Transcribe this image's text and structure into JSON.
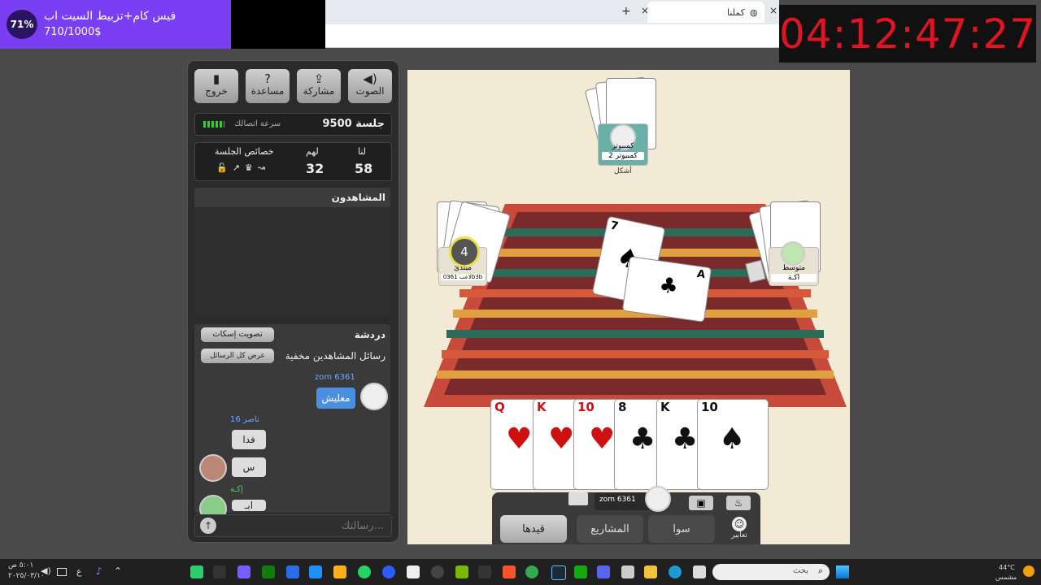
{
  "overlay": {
    "percent": "71%",
    "title": "فيس كام+تزبيط السيت اب",
    "value": "710/1000$",
    "progress": 0.71
  },
  "timer": "04:12:47:27",
  "browser": {
    "tab_title": "كملنا",
    "new_tab": "+",
    "close": "×"
  },
  "toolbar": {
    "exit": "خروج",
    "help": "مساعدة",
    "share": "مشاركة",
    "sound": "الصوت"
  },
  "session": {
    "label": "جلسة 9500",
    "speed_label": "سرعة اتصالك"
  },
  "score": {
    "us_label": "لنا",
    "them_label": "لهم",
    "props_label": "خصائص الجلسة",
    "us": "58",
    "them": "32"
  },
  "viewers": {
    "title": "المشاهدون"
  },
  "chat": {
    "title": "دردشة",
    "mute_vote": "تصويت إسكات",
    "viewers_hidden": "رسائل المشاهدين مخفية",
    "show_all": "عرض كل الرسائل",
    "placeholder": "رسالتك...",
    "messages": [
      {
        "user": "zom 6361",
        "text": "معليش"
      },
      {
        "user": "ناصر 16",
        "text": "فدا"
      },
      {
        "user": "",
        "text": "س"
      },
      {
        "user": "إكـة",
        "text": "ابـ"
      }
    ]
  },
  "players": {
    "top_name": "كمبيوتر",
    "top_sub": "كمبيوتر 2",
    "top_tag": "أشكل",
    "left_name": "مبتدئ",
    "left_tag": "لاعب 0361b3b",
    "left_count": "4",
    "right_name": "متوسط",
    "right_tag": "اكـة",
    "self_name": "zom 6361"
  },
  "table_cards": [
    {
      "rank": "7",
      "suit": "♠"
    },
    {
      "rank": "A",
      "suit": "♣"
    }
  ],
  "hand": [
    {
      "rank": "Q",
      "suit": "♥",
      "color": "#d01010"
    },
    {
      "rank": "K",
      "suit": "♥",
      "color": "#d01010"
    },
    {
      "rank": "10",
      "suit": "♥",
      "color": "#d01010"
    },
    {
      "rank": "8",
      "suit": "♣",
      "color": "#111111"
    },
    {
      "rank": "K",
      "suit": "♣",
      "color": "#111111"
    },
    {
      "rank": "10",
      "suit": "♠",
      "color": "#111111"
    }
  ],
  "actions": {
    "emotes": "تعابير",
    "together": "سوا",
    "projects": "المشاريع",
    "record": "قيدها"
  },
  "taskbar": {
    "search": "بحث",
    "weather_temp": "44°C",
    "weather_desc": "مشمس",
    "lang": "ع",
    "time": "٥:٠١ ص",
    "date": "٢٠٢٥/٠٣/١٠"
  }
}
